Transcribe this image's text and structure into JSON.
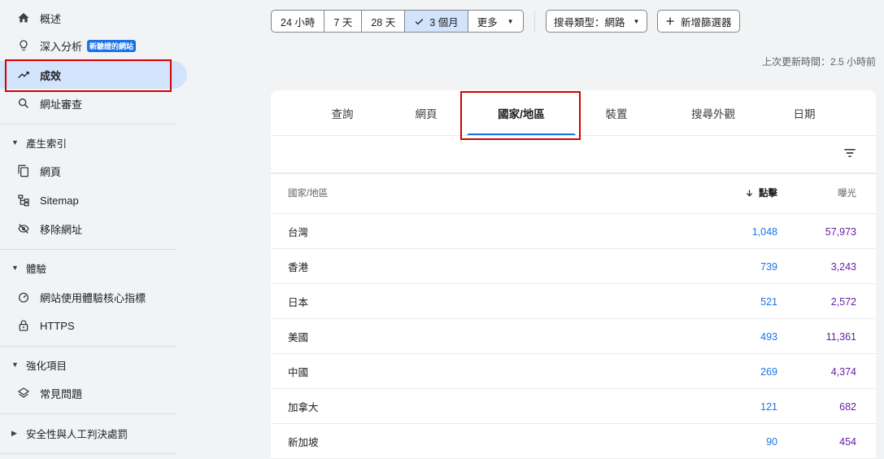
{
  "sidebar": {
    "overview": "概述",
    "insights": "深入分析",
    "insights_badge": "新驗證的網站",
    "performance": "成效",
    "url_inspection": "網址審查",
    "indexing_section": "產生索引",
    "pages": "網頁",
    "sitemap": "Sitemap",
    "removals": "移除網址",
    "experience_section": "體驗",
    "core_web_vitals": "網站使用體驗核心指標",
    "https": "HTTPS",
    "enhancements_section": "強化項目",
    "faq": "常見問題",
    "security_section": "安全性與人工判決處罰"
  },
  "toolbar": {
    "ranges": [
      "24 小時",
      "7 天",
      "28 天",
      "3 個月",
      "更多"
    ],
    "selected_range": "3 個月",
    "search_type": "搜尋類型：網路",
    "add_filter": "新增篩選器"
  },
  "last_updated": "上次更新時間：2.5 小時前",
  "tabs": [
    "查詢",
    "網頁",
    "國家/地區",
    "裝置",
    "搜尋外觀",
    "日期"
  ],
  "active_tab": "國家/地區",
  "table": {
    "col_country": "國家/地區",
    "col_clicks": "點擊",
    "col_impressions": "曝光",
    "rows": [
      {
        "country": "台灣",
        "clicks": "1,048",
        "impressions": "57,973"
      },
      {
        "country": "香港",
        "clicks": "739",
        "impressions": "3,243"
      },
      {
        "country": "日本",
        "clicks": "521",
        "impressions": "2,572"
      },
      {
        "country": "美國",
        "clicks": "493",
        "impressions": "11,361"
      },
      {
        "country": "中國",
        "clicks": "269",
        "impressions": "4,374"
      },
      {
        "country": "加拿大",
        "clicks": "121",
        "impressions": "682"
      },
      {
        "country": "新加坡",
        "clicks": "90",
        "impressions": "454"
      }
    ]
  },
  "colors": {
    "accent": "#1a73e8",
    "active_nav_bg": "#d2e3fc",
    "clicks": "#1a73e8",
    "impressions": "#681da8",
    "highlight": "#d50000"
  }
}
